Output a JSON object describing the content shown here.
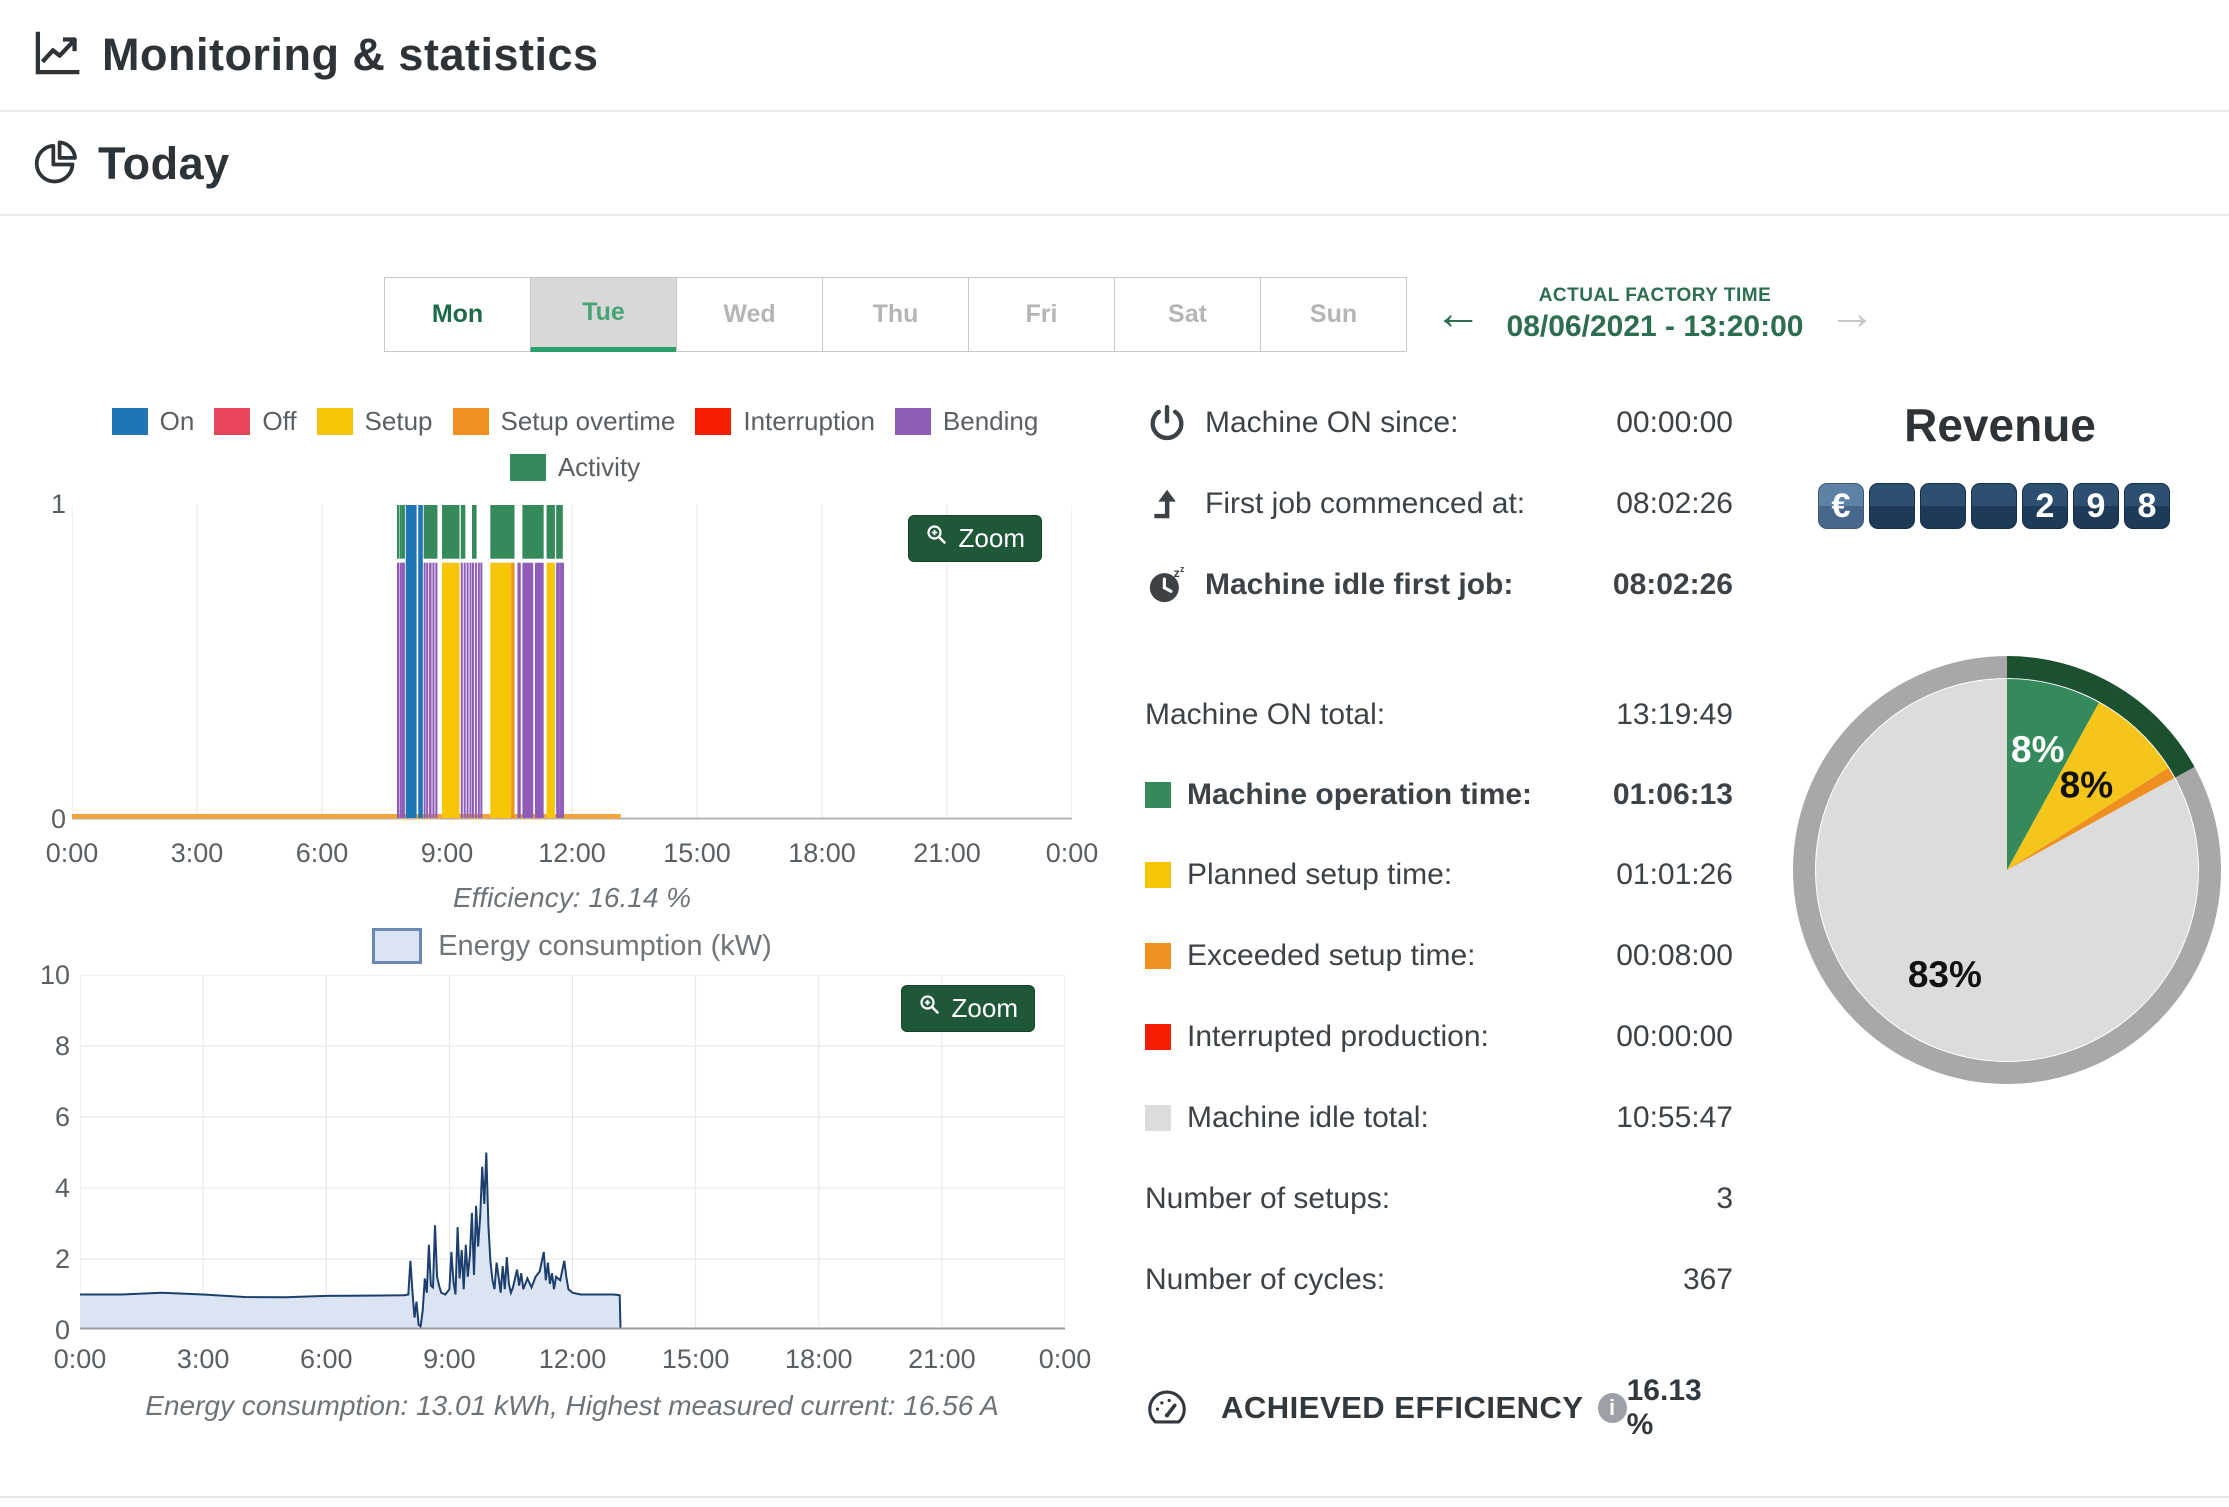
{
  "header": {
    "title": "Monitoring & statistics"
  },
  "section": {
    "title": "Today"
  },
  "day_tabs": [
    {
      "label": "Mon",
      "state": "enabled"
    },
    {
      "label": "Tue",
      "state": "active"
    },
    {
      "label": "Wed",
      "state": "disabled"
    },
    {
      "label": "Thu",
      "state": "disabled"
    },
    {
      "label": "Fri",
      "state": "disabled"
    },
    {
      "label": "Sat",
      "state": "disabled"
    },
    {
      "label": "Sun",
      "state": "disabled"
    }
  ],
  "factory_time": {
    "label": "ACTUAL FACTORY TIME",
    "value": "08/06/2021 - 13:20:00",
    "prev_icon": "←",
    "next_icon": "→"
  },
  "colors": {
    "on": "#2076b4",
    "off": "#e8455a",
    "setup": "#f5c506",
    "setup_overtime": "#ee8f1f",
    "interruption": "#f41d01",
    "bending": "#8f5cb8",
    "activity": "#358a5c",
    "idle": "#dcdcdc",
    "accent_green": "#1f5838",
    "ring_gray": "#a8a8a8",
    "energy_line": "#1d3f6e",
    "energy_fill": "#dbe4f2",
    "machine_on_line": "#f2a53c"
  },
  "status_chart": {
    "zoom_label": "Zoom",
    "legend": [
      {
        "label": "On",
        "key": "on",
        "color": "#2076b4"
      },
      {
        "label": "Off",
        "key": "off",
        "color": "#e8455a"
      },
      {
        "label": "Setup",
        "key": "setup",
        "color": "#f5c506"
      },
      {
        "label": "Setup overtime",
        "key": "setup_overtime",
        "color": "#ee8f1f"
      },
      {
        "label": "Interruption",
        "key": "interruption",
        "color": "#f41d01"
      },
      {
        "label": "Bending",
        "key": "bending",
        "color": "#8f5cb8"
      },
      {
        "label": "Activity",
        "key": "activity",
        "color": "#358a5c"
      }
    ]
  },
  "energy_chart": {
    "zoom_label": "Zoom",
    "legend_label": "Energy consumption (kW)"
  },
  "stats": {
    "top_rows": [
      {
        "icon": "power-icon",
        "label": "Machine ON since:",
        "value": "00:00:00",
        "bold": false
      },
      {
        "icon": "first-job-icon",
        "label": "First job commenced at:",
        "value": "08:02:26",
        "bold": false
      },
      {
        "icon": "idle-clock-icon",
        "label": "Machine idle first job:",
        "value": "08:02:26",
        "bold": true
      }
    ],
    "time_rows": [
      {
        "label": "Machine ON total:",
        "value": "13:19:49",
        "bold": false
      },
      {
        "swatch": "#358a5c",
        "label": "Machine operation time:",
        "value": "01:06:13",
        "bold": true
      },
      {
        "swatch": "#f5c506",
        "label": "Planned setup time:",
        "value": "01:01:26",
        "bold": false
      },
      {
        "swatch": "#ee8f1f",
        "label": "Exceeded setup time:",
        "value": "00:08:00",
        "bold": false
      },
      {
        "swatch": "#f41d01",
        "label": "Interrupted production:",
        "value": "00:00:00",
        "bold": false
      },
      {
        "swatch": "#dcdcdc",
        "label": "Machine idle total:",
        "value": "10:55:47",
        "bold": false
      },
      {
        "label": "Number of setups:",
        "value": "3",
        "bold": false
      },
      {
        "label": "Number of cycles:",
        "value": "367",
        "bold": false
      }
    ],
    "efficiency": {
      "label": "ACHIEVED EFFICIENCY",
      "value": "16.13 %",
      "info_icon": "i"
    }
  },
  "revenue": {
    "title": "Revenue",
    "currency": "€",
    "digits": [
      "",
      "",
      "",
      "2",
      "9",
      "8"
    ]
  },
  "chart_data": [
    {
      "type": "timeline-bar",
      "title": "Machine status timeline",
      "x_ticks": [
        "0:00",
        "3:00",
        "6:00",
        "9:00",
        "12:00",
        "15:00",
        "18:00",
        "21:00",
        "0:00"
      ],
      "x_range_hours": [
        0,
        24
      ],
      "y_ticks": [
        "1",
        "0"
      ],
      "ylim": [
        0,
        1
      ],
      "caption": "Efficiency: 16.14 %",
      "machine_on_span_hours": [
        0,
        13.17
      ],
      "status_band_top_fraction": 0.82,
      "segments": [
        {
          "start": 7.8,
          "end": 7.84,
          "kind": "bending"
        },
        {
          "start": 7.86,
          "end": 7.89,
          "kind": "bending"
        },
        {
          "start": 7.91,
          "end": 7.99,
          "kind": "bending"
        },
        {
          "start": 8.01,
          "end": 8.27,
          "kind": "on"
        },
        {
          "start": 8.31,
          "end": 8.42,
          "kind": "on"
        },
        {
          "start": 8.44,
          "end": 8.48,
          "kind": "bending"
        },
        {
          "start": 8.5,
          "end": 8.55,
          "kind": "bending"
        },
        {
          "start": 8.57,
          "end": 8.63,
          "kind": "bending"
        },
        {
          "start": 8.65,
          "end": 8.7,
          "kind": "bending"
        },
        {
          "start": 8.72,
          "end": 8.77,
          "kind": "bending"
        },
        {
          "start": 8.88,
          "end": 9.3,
          "kind": "setup"
        },
        {
          "start": 9.33,
          "end": 9.37,
          "kind": "bending"
        },
        {
          "start": 9.4,
          "end": 9.44,
          "kind": "bending"
        },
        {
          "start": 9.47,
          "end": 9.51,
          "kind": "bending"
        },
        {
          "start": 9.54,
          "end": 9.57,
          "kind": "bending"
        },
        {
          "start": 9.6,
          "end": 9.64,
          "kind": "bending"
        },
        {
          "start": 9.67,
          "end": 9.71,
          "kind": "bending"
        },
        {
          "start": 9.74,
          "end": 9.77,
          "kind": "bending"
        },
        {
          "start": 9.8,
          "end": 9.83,
          "kind": "bending"
        },
        {
          "start": 10.04,
          "end": 10.54,
          "kind": "setup"
        },
        {
          "start": 10.54,
          "end": 10.62,
          "kind": "setup_overtime"
        },
        {
          "start": 10.69,
          "end": 10.77,
          "kind": "bending"
        },
        {
          "start": 10.81,
          "end": 11.07,
          "kind": "bending"
        },
        {
          "start": 11.11,
          "end": 11.32,
          "kind": "bending"
        },
        {
          "start": 11.39,
          "end": 11.59,
          "kind": "setup"
        },
        {
          "start": 11.62,
          "end": 11.64,
          "kind": "bending"
        },
        {
          "start": 11.66,
          "end": 11.68,
          "kind": "bending"
        },
        {
          "start": 11.71,
          "end": 11.73,
          "kind": "bending"
        },
        {
          "start": 11.76,
          "end": 11.78,
          "kind": "bending"
        }
      ],
      "activity_segments": [
        [
          7.8,
          7.84
        ],
        [
          7.86,
          7.89
        ],
        [
          7.91,
          7.99
        ],
        [
          8.44,
          8.77
        ],
        [
          8.88,
          9.3
        ],
        [
          9.33,
          9.44
        ],
        [
          9.6,
          9.71
        ],
        [
          10.04,
          10.62
        ],
        [
          10.81,
          11.32
        ],
        [
          11.39,
          11.59
        ],
        [
          11.62,
          11.78
        ]
      ]
    },
    {
      "type": "area",
      "title": "Energy consumption (kW)",
      "x_ticks": [
        "0:00",
        "3:00",
        "6:00",
        "9:00",
        "12:00",
        "15:00",
        "18:00",
        "21:00",
        "0:00"
      ],
      "x_range_hours": [
        0,
        24
      ],
      "y_ticks": [
        "10",
        "8",
        "6",
        "4",
        "2",
        "0"
      ],
      "ylim": [
        0,
        10
      ],
      "caption": "Energy consumption: 13.01 kWh, Highest measured current: 16.56 A",
      "points": [
        [
          0,
          1.0
        ],
        [
          1,
          1.0
        ],
        [
          2,
          1.05
        ],
        [
          3,
          1.0
        ],
        [
          4,
          0.93
        ],
        [
          5,
          0.92
        ],
        [
          6,
          0.96
        ],
        [
          7,
          0.97
        ],
        [
          7.9,
          0.98
        ],
        [
          8.0,
          1.0
        ],
        [
          8.05,
          1.95
        ],
        [
          8.1,
          1.1
        ],
        [
          8.15,
          0.35
        ],
        [
          8.2,
          0.8
        ],
        [
          8.25,
          0.15
        ],
        [
          8.3,
          0.1
        ],
        [
          8.35,
          0.55
        ],
        [
          8.4,
          1.45
        ],
        [
          8.45,
          1.05
        ],
        [
          8.5,
          2.4
        ],
        [
          8.55,
          1.25
        ],
        [
          8.6,
          1.2
        ],
        [
          8.65,
          2.95
        ],
        [
          8.7,
          1.5
        ],
        [
          8.75,
          1.25
        ],
        [
          8.8,
          1.05
        ],
        [
          8.9,
          1.0
        ],
        [
          9.0,
          1.15
        ],
        [
          9.05,
          2.2
        ],
        [
          9.1,
          1.35
        ],
        [
          9.15,
          1.0
        ],
        [
          9.2,
          2.9
        ],
        [
          9.25,
          1.45
        ],
        [
          9.3,
          2.25
        ],
        [
          9.35,
          1.15
        ],
        [
          9.4,
          2.4
        ],
        [
          9.45,
          1.5
        ],
        [
          9.5,
          2.1
        ],
        [
          9.55,
          3.3
        ],
        [
          9.6,
          1.55
        ],
        [
          9.65,
          3.5
        ],
        [
          9.7,
          2.35
        ],
        [
          9.75,
          3.2
        ],
        [
          9.8,
          4.6
        ],
        [
          9.85,
          3.55
        ],
        [
          9.9,
          5.0
        ],
        [
          9.95,
          2.95
        ],
        [
          10.0,
          1.95
        ],
        [
          10.05,
          1.4
        ],
        [
          10.1,
          1.15
        ],
        [
          10.15,
          1.9
        ],
        [
          10.2,
          1.5
        ],
        [
          10.25,
          1.05
        ],
        [
          10.3,
          1.8
        ],
        [
          10.35,
          1.15
        ],
        [
          10.4,
          2.05
        ],
        [
          10.45,
          1.3
        ],
        [
          10.5,
          1.05
        ],
        [
          10.55,
          1.2
        ],
        [
          10.6,
          1.45
        ],
        [
          10.65,
          1.7
        ],
        [
          10.7,
          1.25
        ],
        [
          10.75,
          1.6
        ],
        [
          10.8,
          1.15
        ],
        [
          10.9,
          1.45
        ],
        [
          11.0,
          1.2
        ],
        [
          11.1,
          1.5
        ],
        [
          11.2,
          1.65
        ],
        [
          11.3,
          2.2
        ],
        [
          11.35,
          1.4
        ],
        [
          11.4,
          1.9
        ],
        [
          11.45,
          1.3
        ],
        [
          11.5,
          1.6
        ],
        [
          11.55,
          1.15
        ],
        [
          11.6,
          1.5
        ],
        [
          11.7,
          1.4
        ],
        [
          11.8,
          1.95
        ],
        [
          11.85,
          1.5
        ],
        [
          11.9,
          1.15
        ],
        [
          12.0,
          1.05
        ],
        [
          12.2,
          1.0
        ],
        [
          12.6,
          1.0
        ],
        [
          13.0,
          1.0
        ],
        [
          13.15,
          0.98
        ],
        [
          13.17,
          0.05
        ]
      ]
    },
    {
      "type": "pie",
      "title": "Machine time distribution",
      "slices": [
        {
          "label": "Machine operation time",
          "value": 8,
          "color": "#358a5c",
          "text": "8%",
          "text_color": "#ffffff"
        },
        {
          "label": "Planned setup time",
          "value": 8,
          "color": "#f5c51c",
          "text": "8%",
          "text_color": "#111111"
        },
        {
          "label": "Exceeded setup time",
          "value": 1,
          "color": "#ee8f1f",
          "text": "",
          "text_color": ""
        },
        {
          "label": "Machine idle total",
          "value": 83,
          "color": "#dcdcdc",
          "text": "83%",
          "text_color": "#111111"
        }
      ],
      "ring_color": "#a8a8a8",
      "highlight_arc": {
        "from_pct": 0,
        "to_pct": 17,
        "color": "#1c5130"
      }
    }
  ]
}
